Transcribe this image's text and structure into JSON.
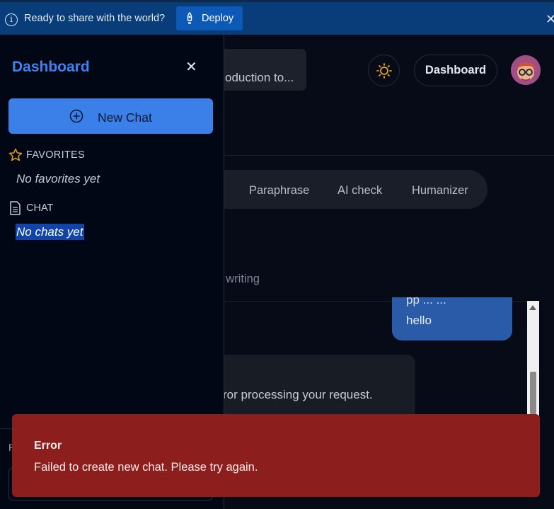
{
  "banner": {
    "message": "Ready to share with the world?",
    "deploy_label": "Deploy",
    "icons": [
      "info-icon",
      "rocket-icon",
      "close-icon"
    ]
  },
  "header": {
    "search_preview": "oduction to...",
    "dashboard_label": "Dashboard"
  },
  "tools": [
    "Paraphrase",
    "AI check",
    "Humanizer"
  ],
  "editor": {
    "hint": "ur writing"
  },
  "messages": {
    "user_cut": "pp  ...  ...",
    "user_text": "hello",
    "bot_text": "ror processing your request."
  },
  "sidebar": {
    "title": "Dashboard",
    "new_chat_label": "New Chat",
    "favorites_label": "FAVORITES",
    "no_favorites": "No favorites yet",
    "chat_label": "CHAT",
    "no_chats": "No chats yet",
    "bottom_label": "R"
  },
  "toast": {
    "title": "Error",
    "message": "Failed to create new chat. Please try again.",
    "color": "#8c1e1e"
  },
  "colors": {
    "accent": "#3b7fe8",
    "banner": "#083d7a",
    "background": "#070b17"
  }
}
